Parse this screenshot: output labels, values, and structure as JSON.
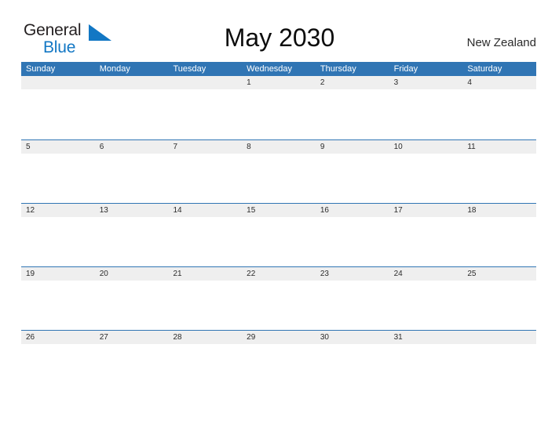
{
  "brand": {
    "name_part1": "General",
    "name_part2": "Blue",
    "flag_icon": "blue-triangle-flag-icon",
    "color_text": "#231f20",
    "color_blue": "#1277c4"
  },
  "header": {
    "title": "May 2030",
    "locale": "New Zealand"
  },
  "theme": {
    "header_blue": "#3075b4",
    "band_gray": "#efefef",
    "text_dark": "#2b2b2b",
    "page_background": "#ffffff"
  },
  "calendar": {
    "weekdays": [
      "Sunday",
      "Monday",
      "Tuesday",
      "Wednesday",
      "Thursday",
      "Friday",
      "Saturday"
    ],
    "weeks": [
      [
        "",
        "",
        "",
        "1",
        "2",
        "3",
        "4"
      ],
      [
        "5",
        "6",
        "7",
        "8",
        "9",
        "10",
        "11"
      ],
      [
        "12",
        "13",
        "14",
        "15",
        "16",
        "17",
        "18"
      ],
      [
        "19",
        "20",
        "21",
        "22",
        "23",
        "24",
        "25"
      ],
      [
        "26",
        "27",
        "28",
        "29",
        "30",
        "31",
        ""
      ]
    ]
  }
}
